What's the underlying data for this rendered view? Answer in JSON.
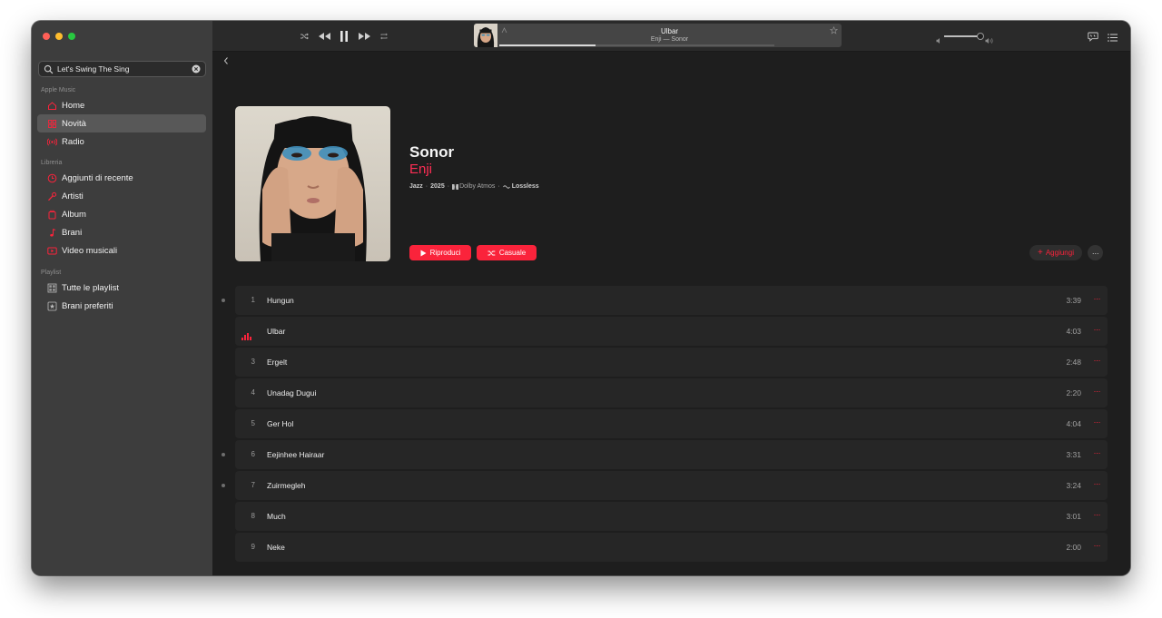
{
  "colors": {
    "accent": "#fa233b",
    "artist": "#ff2d55",
    "traffic_close": "#ff5f57",
    "traffic_min": "#febc2e",
    "traffic_max": "#28c840"
  },
  "sidebar": {
    "search": {
      "value": "Let's Swing The Sing",
      "icon": "search-icon",
      "clear_icon": "clear-icon"
    },
    "sections": [
      {
        "label": "Apple Music"
      },
      {
        "label": "Libreria"
      },
      {
        "label": "Playlist"
      }
    ],
    "items": [
      {
        "label": "Home",
        "icon": "house-icon"
      },
      {
        "label": "Novità",
        "icon": "grid-icon",
        "active": true
      },
      {
        "label": "Radio",
        "icon": "radio-icon"
      },
      {
        "label": "Aggiunti di recente",
        "icon": "clock-icon"
      },
      {
        "label": "Artisti",
        "icon": "microphone-icon"
      },
      {
        "label": "Album",
        "icon": "album-icon"
      },
      {
        "label": "Brani",
        "icon": "music-note-icon"
      },
      {
        "label": "Video musicali",
        "icon": "video-icon"
      },
      {
        "label": "Tutte le playlist",
        "icon": "playlist-grid-icon"
      },
      {
        "label": "Brani preferiti",
        "icon": "star-playlist-icon"
      }
    ]
  },
  "player": {
    "controls": [
      "shuffle-icon",
      "previous-icon",
      "pause-icon",
      "next-icon",
      "repeat-icon"
    ],
    "now_playing": {
      "title": "Ulbar",
      "subtitle": "Enji — Sonor",
      "progress": 0.35
    },
    "volume": 0.95,
    "right_icons": [
      "lyrics-icon",
      "queue-icon"
    ]
  },
  "album": {
    "title": "Sonor",
    "artist": "Enji",
    "meta": {
      "genre": "Jazz",
      "sep1": "·",
      "year": "2025",
      "sep2": "·",
      "dolby": "Dolby Atmos",
      "sep3": "·",
      "lossless": "Lossless"
    },
    "play_label": "Riproduci",
    "shuffle_label": "Casuale",
    "add_label": "Aggiungi",
    "more_label": "···"
  },
  "tracks": [
    {
      "number": "1",
      "name": "Hungun",
      "duration": "3:39",
      "dot": true
    },
    {
      "number": "",
      "name": "Ulbar",
      "duration": "4:03",
      "playing": true
    },
    {
      "number": "3",
      "name": "Ergelt",
      "duration": "2:48"
    },
    {
      "number": "4",
      "name": "Unadag Dugui",
      "duration": "2:20"
    },
    {
      "number": "5",
      "name": "Ger Hol",
      "duration": "4:04"
    },
    {
      "number": "6",
      "name": "Eejinhee Hairaar",
      "duration": "3:31",
      "dot": true
    },
    {
      "number": "7",
      "name": "Zuirmegleh",
      "duration": "3:24",
      "dot": true
    },
    {
      "number": "8",
      "name": "Much",
      "duration": "3:01"
    },
    {
      "number": "9",
      "name": "Neke",
      "duration": "2:00"
    }
  ],
  "track_more_label": "···"
}
